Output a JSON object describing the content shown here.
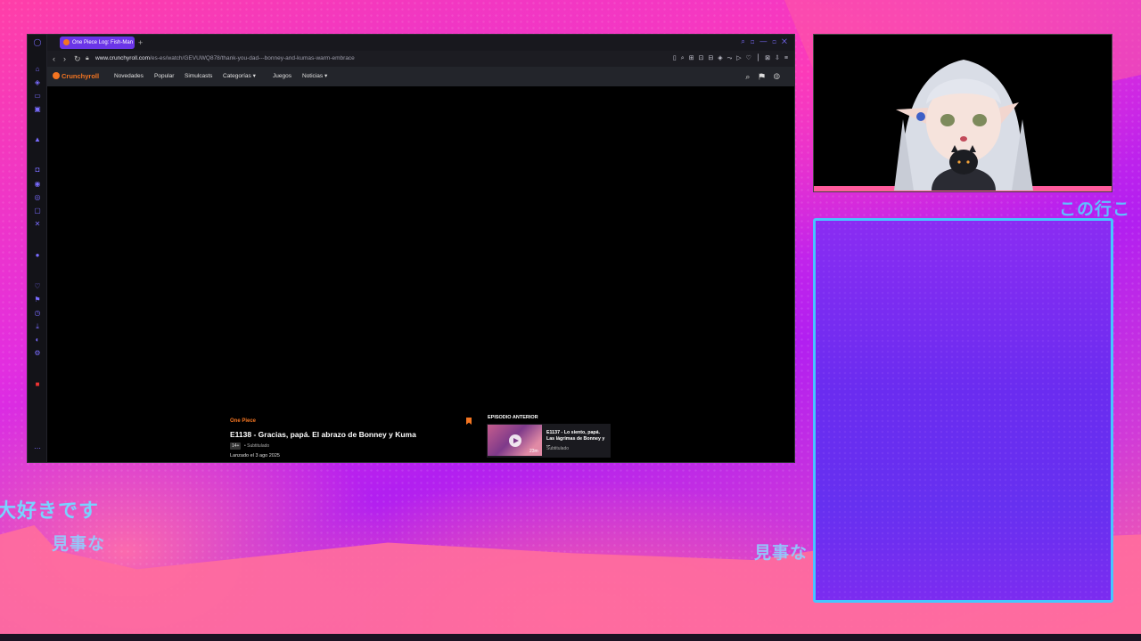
{
  "browser": {
    "tab_title": "One Piece Log: Fish-Man",
    "url_domain": "www.crunchyroll.com",
    "url_path": "/es-es/watch/GEVUWQ878/thank-you-dad---bonney-and-kumas-warm-embrace"
  },
  "crunchyroll": {
    "logo": "Crunchyroll",
    "nav": [
      "Novedades",
      "Popular",
      "Simulcasts",
      "Categorías",
      "Juegos",
      "Noticias"
    ]
  },
  "episode": {
    "series": "One Piece",
    "title": "E1138 - Gracias, papá. El abrazo de Bonney y Kuma",
    "rating": "14+",
    "audio": "• Subtitulado",
    "release": "Lanzado el 3 ago 2025"
  },
  "previous": {
    "label": "EPISODIO ANTERIOR",
    "title": "E1137 - Lo siento, papá. Las lágrimas de Bonney y ...",
    "audio": "Subtitulado",
    "duration": "23m"
  },
  "overlay": {
    "jp_text_1": "大好きです",
    "jp_text_2": "見事な",
    "jp_text_3": "見事な",
    "jp_text_4": "この行こ"
  },
  "colors": {
    "crunchyroll_orange": "#f47521",
    "chat_border": "#46c6ff",
    "accent_purple": "#6b35e8"
  }
}
